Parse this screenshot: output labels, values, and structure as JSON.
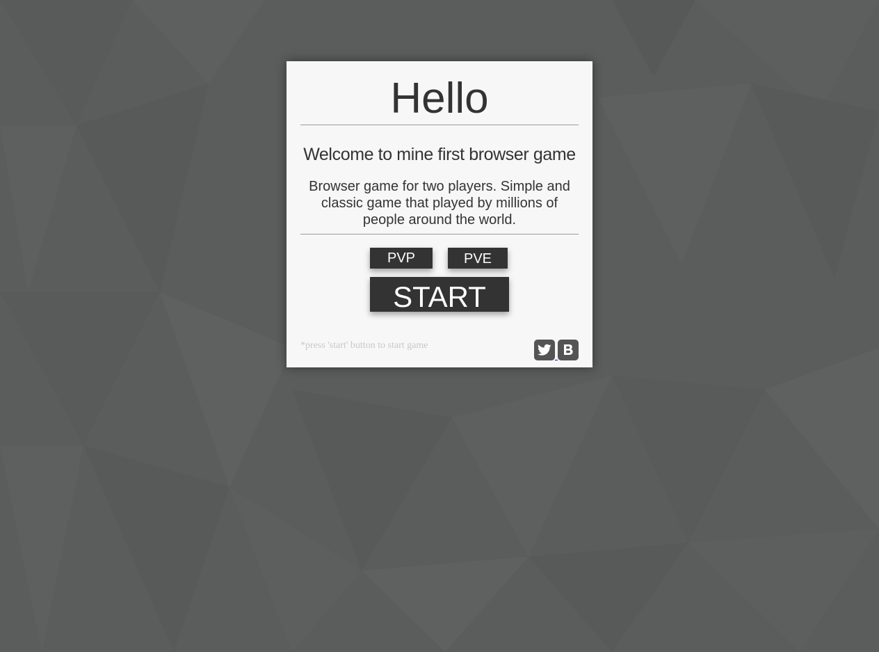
{
  "card": {
    "title": "Hello",
    "subtitle": "Welcome to mine first browser game",
    "description": "Browser game for two players. Simple and classic game that played by millions of people around the world."
  },
  "buttons": {
    "pvp_label": "PVP",
    "pve_label": "PVE",
    "start_label": "START"
  },
  "footer": {
    "hint": "*press 'start' button to start game",
    "social_icons": [
      "twitter-icon",
      "vk-icon"
    ]
  },
  "colors": {
    "background": "#5b5d5c",
    "card": "#f7f7f7",
    "button": "#333333",
    "button_text": "#ffffff",
    "text": "#333333",
    "hint": "#c8c8c8",
    "social": "#545454"
  }
}
